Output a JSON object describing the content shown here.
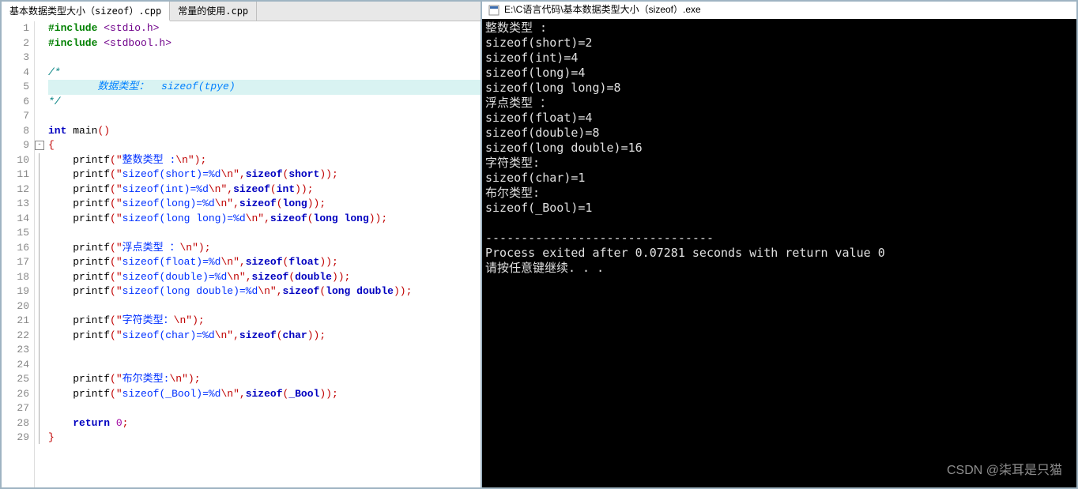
{
  "tabs": [
    {
      "label": "基本数据类型大小（sizeof）.cpp",
      "active": true
    },
    {
      "label": "常量的使用.cpp",
      "active": false
    }
  ],
  "code": {
    "lines": [
      {
        "n": 1,
        "tokens": [
          [
            "pre",
            "#include "
          ],
          [
            "inc",
            "<stdio.h>"
          ]
        ]
      },
      {
        "n": 2,
        "tokens": [
          [
            "pre",
            "#include "
          ],
          [
            "inc",
            "<stdbool.h>"
          ]
        ]
      },
      {
        "n": 3,
        "tokens": []
      },
      {
        "n": 4,
        "tokens": [
          [
            "cmt",
            "/*"
          ]
        ]
      },
      {
        "n": 5,
        "hl": true,
        "tokens": [
          [
            "cmt",
            "        "
          ],
          [
            "cmt-b",
            "数据类型：  sizeof(tpye)"
          ]
        ]
      },
      {
        "n": 6,
        "tokens": [
          [
            "cmt",
            "*/"
          ]
        ]
      },
      {
        "n": 7,
        "tokens": []
      },
      {
        "n": 8,
        "tokens": [
          [
            "kw",
            "int "
          ],
          [
            "fn",
            "main"
          ],
          [
            "punc",
            "()"
          ]
        ]
      },
      {
        "n": 9,
        "fold": true,
        "tokens": [
          [
            "brace",
            "{"
          ]
        ]
      },
      {
        "n": 10,
        "tokens": [
          [
            "",
            "    "
          ],
          [
            "fn",
            "printf"
          ],
          [
            "punc",
            "("
          ],
          [
            "str",
            "\""
          ],
          [
            "strcn",
            "整数类型 :"
          ],
          [
            "str",
            "\\n\""
          ],
          [
            "punc",
            ")"
          ],
          [
            "punc",
            ";"
          ]
        ]
      },
      {
        "n": 11,
        "tokens": [
          [
            "",
            "    "
          ],
          [
            "fn",
            "printf"
          ],
          [
            "punc",
            "("
          ],
          [
            "str",
            "\""
          ],
          [
            "strcn",
            "sizeof(short)=%d"
          ],
          [
            "str",
            "\\n\""
          ],
          [
            "punc",
            ","
          ],
          [
            "kw",
            "sizeof"
          ],
          [
            "punc",
            "("
          ],
          [
            "kw",
            "short"
          ],
          [
            "punc",
            "))"
          ],
          [
            "punc",
            ";"
          ]
        ]
      },
      {
        "n": 12,
        "tokens": [
          [
            "",
            "    "
          ],
          [
            "fn",
            "printf"
          ],
          [
            "punc",
            "("
          ],
          [
            "str",
            "\""
          ],
          [
            "strcn",
            "sizeof(int)=%d"
          ],
          [
            "str",
            "\\n\""
          ],
          [
            "punc",
            ","
          ],
          [
            "kw",
            "sizeof"
          ],
          [
            "punc",
            "("
          ],
          [
            "kw",
            "int"
          ],
          [
            "punc",
            "))"
          ],
          [
            "punc",
            ";"
          ]
        ]
      },
      {
        "n": 13,
        "tokens": [
          [
            "",
            "    "
          ],
          [
            "fn",
            "printf"
          ],
          [
            "punc",
            "("
          ],
          [
            "str",
            "\""
          ],
          [
            "strcn",
            "sizeof(long)=%d"
          ],
          [
            "str",
            "\\n\""
          ],
          [
            "punc",
            ","
          ],
          [
            "kw",
            "sizeof"
          ],
          [
            "punc",
            "("
          ],
          [
            "kw",
            "long"
          ],
          [
            "punc",
            "))"
          ],
          [
            "punc",
            ";"
          ]
        ]
      },
      {
        "n": 14,
        "tokens": [
          [
            "",
            "    "
          ],
          [
            "fn",
            "printf"
          ],
          [
            "punc",
            "("
          ],
          [
            "str",
            "\""
          ],
          [
            "strcn",
            "sizeof(long long)=%d"
          ],
          [
            "str",
            "\\n\""
          ],
          [
            "punc",
            ","
          ],
          [
            "kw",
            "sizeof"
          ],
          [
            "punc",
            "("
          ],
          [
            "kw",
            "long long"
          ],
          [
            "punc",
            "))"
          ],
          [
            "punc",
            ";"
          ]
        ]
      },
      {
        "n": 15,
        "tokens": []
      },
      {
        "n": 16,
        "tokens": [
          [
            "",
            "    "
          ],
          [
            "fn",
            "printf"
          ],
          [
            "punc",
            "("
          ],
          [
            "str",
            "\""
          ],
          [
            "strcn",
            "浮点类型 ："
          ],
          [
            "str",
            "\\n\""
          ],
          [
            "punc",
            ")"
          ],
          [
            "punc",
            ";"
          ]
        ]
      },
      {
        "n": 17,
        "tokens": [
          [
            "",
            "    "
          ],
          [
            "fn",
            "printf"
          ],
          [
            "punc",
            "("
          ],
          [
            "str",
            "\""
          ],
          [
            "strcn",
            "sizeof(float)=%d"
          ],
          [
            "str",
            "\\n\""
          ],
          [
            "punc",
            ","
          ],
          [
            "kw",
            "sizeof"
          ],
          [
            "punc",
            "("
          ],
          [
            "kw",
            "float"
          ],
          [
            "punc",
            "))"
          ],
          [
            "punc",
            ";"
          ]
        ]
      },
      {
        "n": 18,
        "tokens": [
          [
            "",
            "    "
          ],
          [
            "fn",
            "printf"
          ],
          [
            "punc",
            "("
          ],
          [
            "str",
            "\""
          ],
          [
            "strcn",
            "sizeof(double)=%d"
          ],
          [
            "str",
            "\\n\""
          ],
          [
            "punc",
            ","
          ],
          [
            "kw",
            "sizeof"
          ],
          [
            "punc",
            "("
          ],
          [
            "kw",
            "double"
          ],
          [
            "punc",
            "))"
          ],
          [
            "punc",
            ";"
          ]
        ]
      },
      {
        "n": 19,
        "tokens": [
          [
            "",
            "    "
          ],
          [
            "fn",
            "printf"
          ],
          [
            "punc",
            "("
          ],
          [
            "str",
            "\""
          ],
          [
            "strcn",
            "sizeof(long double)=%d"
          ],
          [
            "str",
            "\\n\""
          ],
          [
            "punc",
            ","
          ],
          [
            "kw",
            "sizeof"
          ],
          [
            "punc",
            "("
          ],
          [
            "kw",
            "long double"
          ],
          [
            "punc",
            "))"
          ],
          [
            "punc",
            ";"
          ]
        ]
      },
      {
        "n": 20,
        "tokens": []
      },
      {
        "n": 21,
        "tokens": [
          [
            "",
            "    "
          ],
          [
            "fn",
            "printf"
          ],
          [
            "punc",
            "("
          ],
          [
            "str",
            "\""
          ],
          [
            "strcn",
            "字符类型："
          ],
          [
            "str",
            "\\n\""
          ],
          [
            "punc",
            ")"
          ],
          [
            "punc",
            ";"
          ]
        ]
      },
      {
        "n": 22,
        "tokens": [
          [
            "",
            "    "
          ],
          [
            "fn",
            "printf"
          ],
          [
            "punc",
            "("
          ],
          [
            "str",
            "\""
          ],
          [
            "strcn",
            "sizeof(char)=%d"
          ],
          [
            "str",
            "\\n\""
          ],
          [
            "punc",
            ","
          ],
          [
            "kw",
            "sizeof"
          ],
          [
            "punc",
            "("
          ],
          [
            "kw",
            "char"
          ],
          [
            "punc",
            "))"
          ],
          [
            "punc",
            ";"
          ]
        ]
      },
      {
        "n": 23,
        "tokens": []
      },
      {
        "n": 24,
        "tokens": []
      },
      {
        "n": 25,
        "tokens": [
          [
            "",
            "    "
          ],
          [
            "fn",
            "printf"
          ],
          [
            "punc",
            "("
          ],
          [
            "str",
            "\""
          ],
          [
            "strcn",
            "布尔类型:"
          ],
          [
            "str",
            "\\n\""
          ],
          [
            "punc",
            ")"
          ],
          [
            "punc",
            ";"
          ]
        ]
      },
      {
        "n": 26,
        "tokens": [
          [
            "",
            "    "
          ],
          [
            "fn",
            "printf"
          ],
          [
            "punc",
            "("
          ],
          [
            "str",
            "\""
          ],
          [
            "strcn",
            "sizeof(_Bool)=%d"
          ],
          [
            "str",
            "\\n\""
          ],
          [
            "punc",
            ","
          ],
          [
            "kw",
            "sizeof"
          ],
          [
            "punc",
            "("
          ],
          [
            "kw",
            "_Bool"
          ],
          [
            "punc",
            "))"
          ],
          [
            "punc",
            ";"
          ]
        ]
      },
      {
        "n": 27,
        "tokens": []
      },
      {
        "n": 28,
        "tokens": [
          [
            "",
            "    "
          ],
          [
            "kw",
            "return "
          ],
          [
            "num",
            "0"
          ],
          [
            "punc",
            ";"
          ]
        ]
      },
      {
        "n": 29,
        "tokens": [
          [
            "brace",
            "}"
          ]
        ]
      }
    ]
  },
  "console": {
    "title": "E:\\C语言代码\\基本数据类型大小（sizeof）.exe",
    "lines": [
      "整数类型 :",
      "sizeof(short)=2",
      "sizeof(int)=4",
      "sizeof(long)=4",
      "sizeof(long long)=8",
      "浮点类型 ：",
      "sizeof(float)=4",
      "sizeof(double)=8",
      "sizeof(long double)=16",
      "字符类型:",
      "sizeof(char)=1",
      "布尔类型:",
      "sizeof(_Bool)=1",
      "",
      "--------------------------------",
      "Process exited after 0.07281 seconds with return value 0",
      "请按任意键继续. . ."
    ]
  },
  "watermark": "CSDN @柒耳是只猫"
}
